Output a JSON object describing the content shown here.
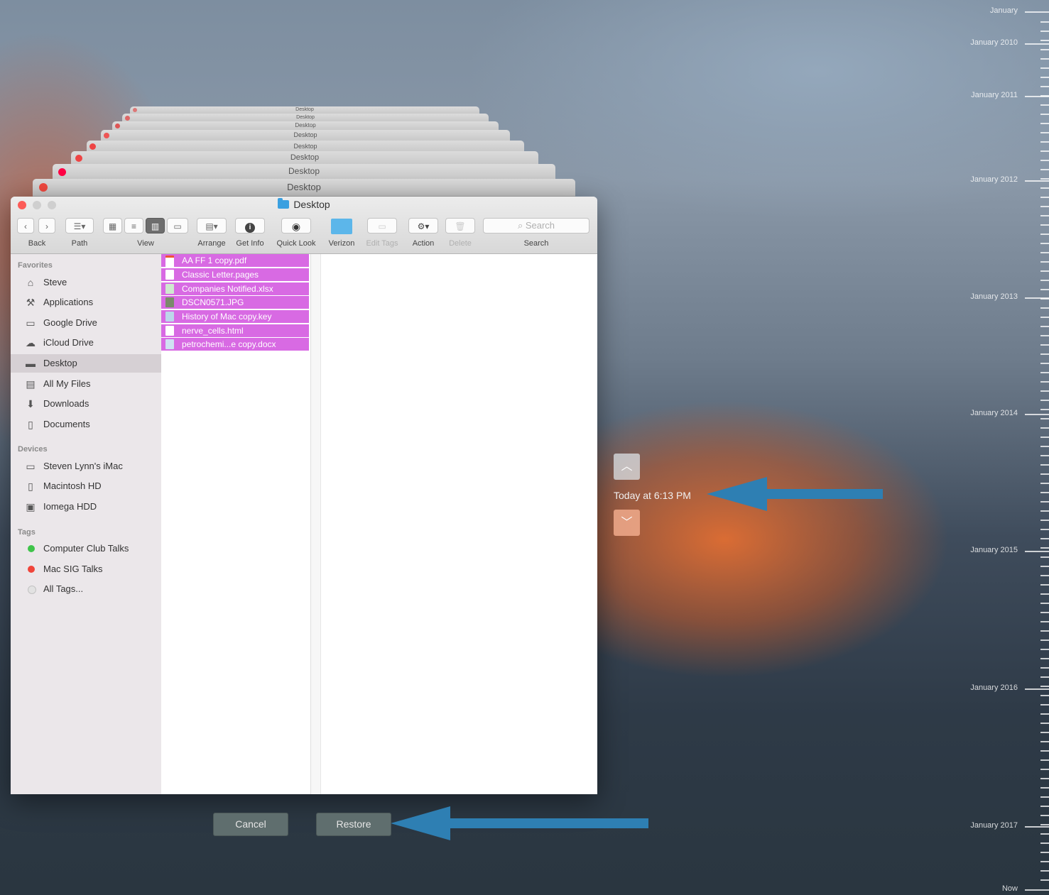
{
  "ghost_windows": [
    {
      "title": "Desktop"
    },
    {
      "title": "Desktop"
    },
    {
      "title": "Desktop"
    },
    {
      "title": "Desktop"
    },
    {
      "title": "Desktop"
    },
    {
      "title": "Desktop"
    },
    {
      "title": "Desktop"
    },
    {
      "title": "Desktop"
    }
  ],
  "window": {
    "title": "Desktop"
  },
  "toolbar": {
    "back": "Back",
    "path": "Path",
    "view": "View",
    "arrange": "Arrange",
    "get_info": "Get Info",
    "quick_look": "Quick Look",
    "verizon": "Verizon",
    "edit_tags": "Edit Tags",
    "action": "Action",
    "delete": "Delete",
    "search_label": "Search",
    "search_placeholder": "Search"
  },
  "sidebar": {
    "favorites_header": "Favorites",
    "favorites": [
      {
        "label": "Steve",
        "icon": "home-icon"
      },
      {
        "label": "Applications",
        "icon": "applications-icon"
      },
      {
        "label": "Google Drive",
        "icon": "folder-icon"
      },
      {
        "label": "iCloud Drive",
        "icon": "cloud-icon"
      },
      {
        "label": "Desktop",
        "icon": "desktop-icon",
        "selected": true
      },
      {
        "label": "All My Files",
        "icon": "files-icon"
      },
      {
        "label": "Downloads",
        "icon": "download-icon"
      },
      {
        "label": "Documents",
        "icon": "documents-icon"
      }
    ],
    "devices_header": "Devices",
    "devices": [
      {
        "label": "Steven Lynn's iMac",
        "icon": "imac-icon"
      },
      {
        "label": "Macintosh HD",
        "icon": "disk-icon"
      },
      {
        "label": "Iomega HDD",
        "icon": "drive-icon"
      }
    ],
    "tags_header": "Tags",
    "tags": [
      {
        "label": "Computer Club Talks",
        "color": "#3fc44a"
      },
      {
        "label": "Mac SIG Talks",
        "color": "#f0453a"
      },
      {
        "label": "All Tags...",
        "color": "#d8d8d8"
      }
    ]
  },
  "files": [
    {
      "name": "AA FF 1 copy.pdf"
    },
    {
      "name": "Classic Letter.pages"
    },
    {
      "name": "Companies Notified.xlsx"
    },
    {
      "name": "DSCN0571.JPG"
    },
    {
      "name": "History of Mac copy.key"
    },
    {
      "name": "nerve_cells.html"
    },
    {
      "name": "petrochemi...e copy.docx"
    }
  ],
  "time_machine": {
    "current_time": "Today at 6:13 PM",
    "cancel_label": "Cancel",
    "restore_label": "Restore",
    "up_icon": "chevron-up-icon",
    "down_icon": "chevron-down-icon"
  },
  "timeline": {
    "labels": [
      "January",
      "January 2010",
      "January 2011",
      "January 2012",
      "January 2013",
      "January 2014",
      "January 2015",
      "January 2016",
      "January 2017",
      "Now"
    ]
  },
  "colors": {
    "selection": "#d86ae3",
    "arrow": "#2e7fb3",
    "close": "#fc5b57",
    "tag_green": "#3fc44a",
    "tag_red": "#f0453a"
  }
}
